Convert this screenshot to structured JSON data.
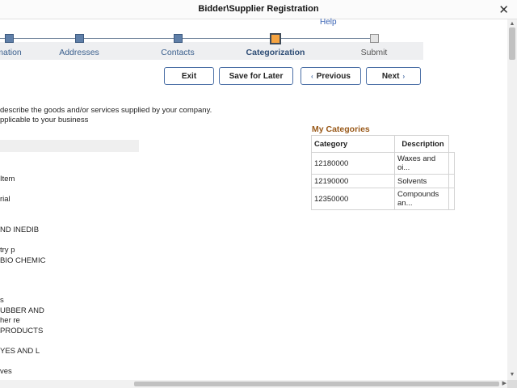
{
  "window": {
    "title": "Bidder\\Supplier Registration",
    "close_glyph": "✕"
  },
  "help_label": "Help",
  "steps": [
    {
      "label": "mation",
      "state": "done"
    },
    {
      "label": "Addresses",
      "state": "done"
    },
    {
      "label": "Contacts",
      "state": "done"
    },
    {
      "label": "Categorization",
      "state": "active"
    },
    {
      "label": "Submit",
      "state": "future"
    }
  ],
  "buttons": {
    "exit": "Exit",
    "save_later": "Save for Later",
    "previous": "Previous",
    "next": "Next",
    "prev_icon": "‹",
    "next_icon": "›"
  },
  "intro": {
    "line1": "describe the goods and/or services supplied by your company.",
    "line2": "pplicable to your business"
  },
  "cut_items": [
    "Item",
    "rial",
    "ND INEDIB",
    "try p",
    "BIO CHEMIC",
    "s",
    "UBBER AND",
    "her re",
    "PRODUCTS",
    "YES AND L",
    "ves"
  ],
  "my_categories": {
    "title": "My Categories",
    "columns": [
      "Category",
      "Description"
    ],
    "rows": [
      {
        "category": "12180000",
        "description": "Waxes and oi..."
      },
      {
        "category": "12190000",
        "description": "Solvents"
      },
      {
        "category": "12350000",
        "description": "Compounds an..."
      }
    ]
  },
  "scrollbar": {
    "up_glyph": "▲",
    "down_glyph": "▼",
    "right_glyph": "▶"
  },
  "colors": {
    "active_step": "#f6a441",
    "done_step": "#5f7fa8",
    "category_title": "#9a5a1a",
    "link": "#3a64b5"
  }
}
